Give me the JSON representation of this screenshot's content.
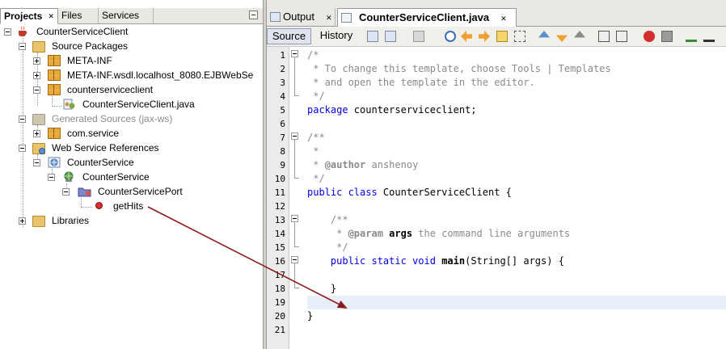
{
  "projects_panel": {
    "tabs": [
      {
        "label": "Projects",
        "close": "✕"
      },
      {
        "label": "Files"
      },
      {
        "label": "Services"
      }
    ]
  },
  "tree": [
    {
      "label": "CounterServiceClient",
      "icon": "java-project-icon"
    },
    {
      "label": "Source Packages",
      "icon": "source-packages-icon"
    },
    {
      "label": "META-INF",
      "icon": "package-icon"
    },
    {
      "label": "META-INF.wsdl.localhost_8080.EJBWebSe",
      "icon": "package-icon"
    },
    {
      "label": "counterserviceclient",
      "icon": "package-icon"
    },
    {
      "label": "CounterServiceClient.java",
      "icon": "java-file-icon"
    },
    {
      "label": "Generated Sources (jax-ws)",
      "icon": "generated-sources-icon"
    },
    {
      "label": "com.service",
      "icon": "package-icon"
    },
    {
      "label": "Web Service References",
      "icon": "ws-references-icon"
    },
    {
      "label": "CounterService",
      "icon": "web-service-icon"
    },
    {
      "label": "CounterService",
      "icon": "service-globe-icon"
    },
    {
      "label": "CounterServicePort",
      "icon": "port-folder-icon"
    },
    {
      "label": "getHits",
      "icon": "operation-icon"
    },
    {
      "label": "Libraries",
      "icon": "libraries-icon"
    }
  ],
  "editor": {
    "tabs": [
      {
        "label": "Output",
        "close": "✕"
      },
      {
        "label": "CounterServiceClient.java",
        "close": "✕"
      }
    ],
    "toolbar": {
      "source": "Source",
      "history": "History"
    },
    "line_numbers": [
      "1",
      "2",
      "3",
      "4",
      "5",
      "6",
      "7",
      "8",
      "9",
      "10",
      "11",
      "12",
      "13",
      "14",
      "15",
      "16",
      "17",
      "18",
      "19",
      "20",
      "21"
    ],
    "code": [
      {
        "parts": [
          {
            "t": "/*",
            "c": "cm"
          }
        ]
      },
      {
        "parts": [
          {
            "t": " * To change this template, choose Tools | Templates",
            "c": "cm"
          }
        ]
      },
      {
        "parts": [
          {
            "t": " * and open the template in the editor.",
            "c": "cm"
          }
        ]
      },
      {
        "parts": [
          {
            "t": " */",
            "c": "cm"
          }
        ]
      },
      {
        "parts": [
          {
            "t": "package",
            "c": "kw"
          },
          {
            "t": " counterserviceclient;",
            "c": ""
          }
        ]
      },
      {
        "parts": []
      },
      {
        "parts": [
          {
            "t": "/**",
            "c": "cm"
          }
        ]
      },
      {
        "parts": [
          {
            "t": " *",
            "c": "cm"
          }
        ]
      },
      {
        "parts": [
          {
            "t": " * ",
            "c": "cm"
          },
          {
            "t": "@author",
            "c": "cm bd"
          },
          {
            "t": " anshenoy",
            "c": "cm"
          }
        ]
      },
      {
        "parts": [
          {
            "t": " */",
            "c": "cm"
          }
        ]
      },
      {
        "parts": [
          {
            "t": "public class",
            "c": "kw"
          },
          {
            "t": " CounterServiceClient {",
            "c": ""
          }
        ]
      },
      {
        "parts": []
      },
      {
        "parts": [
          {
            "t": "    /**",
            "c": "cm"
          }
        ]
      },
      {
        "parts": [
          {
            "t": "     * ",
            "c": "cm"
          },
          {
            "t": "@param",
            "c": "cm bd"
          },
          {
            "t": " ",
            "c": "cm"
          },
          {
            "t": "args",
            "c": "bd"
          },
          {
            "t": " the command line arguments",
            "c": "cm"
          }
        ]
      },
      {
        "parts": [
          {
            "t": "     */",
            "c": "cm"
          }
        ]
      },
      {
        "parts": [
          {
            "t": "    public static void",
            "c": "kw"
          },
          {
            "t": " ",
            "c": ""
          },
          {
            "t": "main",
            "c": "bd"
          },
          {
            "t": "(String[] args) {",
            "c": ""
          }
        ]
      },
      {
        "parts": []
      },
      {
        "parts": [
          {
            "t": "    }",
            "c": ""
          }
        ]
      },
      {
        "parts": []
      },
      {
        "parts": [
          {
            "t": "}",
            "c": ""
          }
        ]
      },
      {
        "parts": []
      }
    ],
    "highlighted_line": 19
  }
}
